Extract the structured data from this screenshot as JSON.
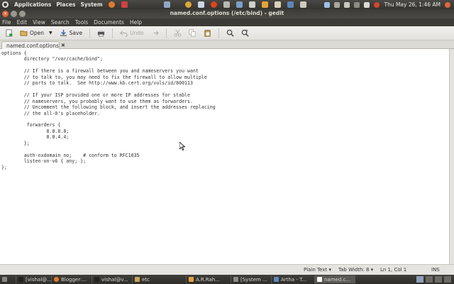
{
  "top_panel": {
    "menus": [
      "Applications",
      "Places",
      "System"
    ],
    "clock": "Thu May 26,  1:46 AM"
  },
  "window": {
    "title": "named.conf.options (/etc/bind) - gedit"
  },
  "menubar": [
    "File",
    "Edit",
    "View",
    "Search",
    "Tools",
    "Documents",
    "Help"
  ],
  "toolbar": {
    "open_label": "Open",
    "save_label": "Save",
    "undo_label": "Undo"
  },
  "tab": {
    "label": "named.conf.options",
    "close_glyph": "✖"
  },
  "editor": {
    "content": "options {\n        directory \"/var/cache/bind\";\n\n        // If there is a firewall between you and nameservers you want\n        // to talk to, you may need to fix the firewall to allow multiple\n        // ports to talk.  See http://www.kb.cert.org/vuls/id/800113\n\n        // If your ISP provided one or more IP addresses for stable\n        // nameservers, you probably want to use them as forwarders.\n        // Uncomment the following block, and insert the addresses replacing\n        // the all-0's placeholder.\n\n         forwarders {\n                8.8.8.8;\n                8.8.4.4;\n        };\n\n        auth-nxdomain no;    # conform to RFC1035\n        listen-on-v6 { any; };\n};"
  },
  "statusbar": {
    "language": "Plain Text",
    "tab_width": "Tab Width:  8",
    "position": "Ln 1, Col 1",
    "mode": "INS"
  },
  "taskbar": [
    {
      "label": "[vishal@..."
    },
    {
      "label": "Blogger:..."
    },
    {
      "label": "vishal@v..."
    },
    {
      "label": "etc"
    },
    {
      "label": "A.R.Rah..."
    },
    {
      "label": "[System ..."
    },
    {
      "label": "Artha - T..."
    },
    {
      "label": "named.c..."
    }
  ],
  "colors": {
    "panel": "#3c3b37",
    "close_button": "#e0663a",
    "editor_bg": "#ffffff"
  }
}
